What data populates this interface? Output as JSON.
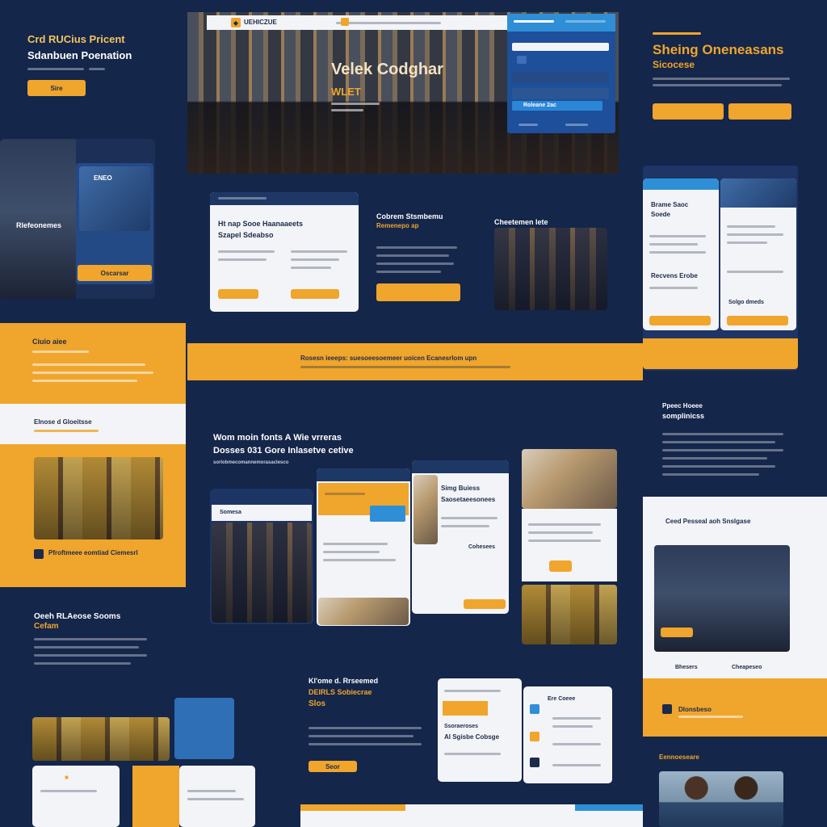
{
  "colors": {
    "navy": "#14264a",
    "accent": "#f0a52c",
    "blue": "#2f8fd6",
    "card": "#f3f4f7"
  },
  "top_left": {
    "title_1": "Crd RUCius Pricent",
    "title_2": "Sdanbuen Poenation",
    "button": "Sire"
  },
  "hero": {
    "nav_brand": "UEHICZUE",
    "headline": "Velek Codghar",
    "subline": "WLET",
    "form_buttons": [
      "Roleane 2ac"
    ]
  },
  "top_right": {
    "title_1": "Sheing Oneneasans",
    "title_2": "Sicocese",
    "buttons": [
      "",
      ""
    ]
  },
  "left_mobile": {
    "label": "Rlefeonemes",
    "badge": "ENEO",
    "button": "Oscarsar"
  },
  "center_row": {
    "card1_heading": "Ht nap Sooe Haanaaeets",
    "card1_sub": "Szapel Sdeabso",
    "card2_heading": "Cobrem Stsmbemu",
    "card2_sub": "Remenepo ap",
    "card3_heading": "Cheetemen lete"
  },
  "right_cards": {
    "heading_1": "Brame Saoc",
    "heading_2": "Soede",
    "sub_1": "Recvens Erobe",
    "link": "Solgo dmeds"
  },
  "orange_banner": "Rosesn ieeeps: suesoeesoemeer uoicen Ecanesrlom upn",
  "left_orange": {
    "heading": "Ciuio aiee",
    "strip": "Elnose d Gloeitsse",
    "caption": "Pfroftmeee eomtiad Ciemesrl"
  },
  "right_mid": {
    "heading_1": "Ppeec Hoeee",
    "heading_2": "somplinicss"
  },
  "center_mid": {
    "headline_1": "Wom moin fonts A Wie vrreras",
    "headline_2": "Dosses 031 Gore Inlasetve cetive",
    "caption": "sorlobmecomannemorasaclesco"
  },
  "device_cards": {
    "label_1": "Somesa",
    "label_2": "Simg Buiess",
    "label_3": "Saosetaeesonees",
    "label_4": "Cohesees"
  },
  "right_white": {
    "heading": "Ceed Pesseal aoh Snslgase",
    "caption_1": "Bhesers",
    "caption_2": "Cheapeseo"
  },
  "right_orange_strip": "Dlonsbeso",
  "bottom_left": {
    "heading_1": "Oeeh RLAeose Sooms",
    "heading_2": "Cefam"
  },
  "bottom_center": {
    "heading_1": "Kl'ome d. Rrseemed",
    "heading_2": "DEIRLS Sobiecrae",
    "heading_3": "Slos",
    "button": "Seor",
    "card_title": "Ssoraeroses",
    "card_sub": "Al Sgisbe Cobsge",
    "card2_title": "Ere Coeee"
  },
  "bottom_right": {
    "label": "Eennoeseare"
  }
}
